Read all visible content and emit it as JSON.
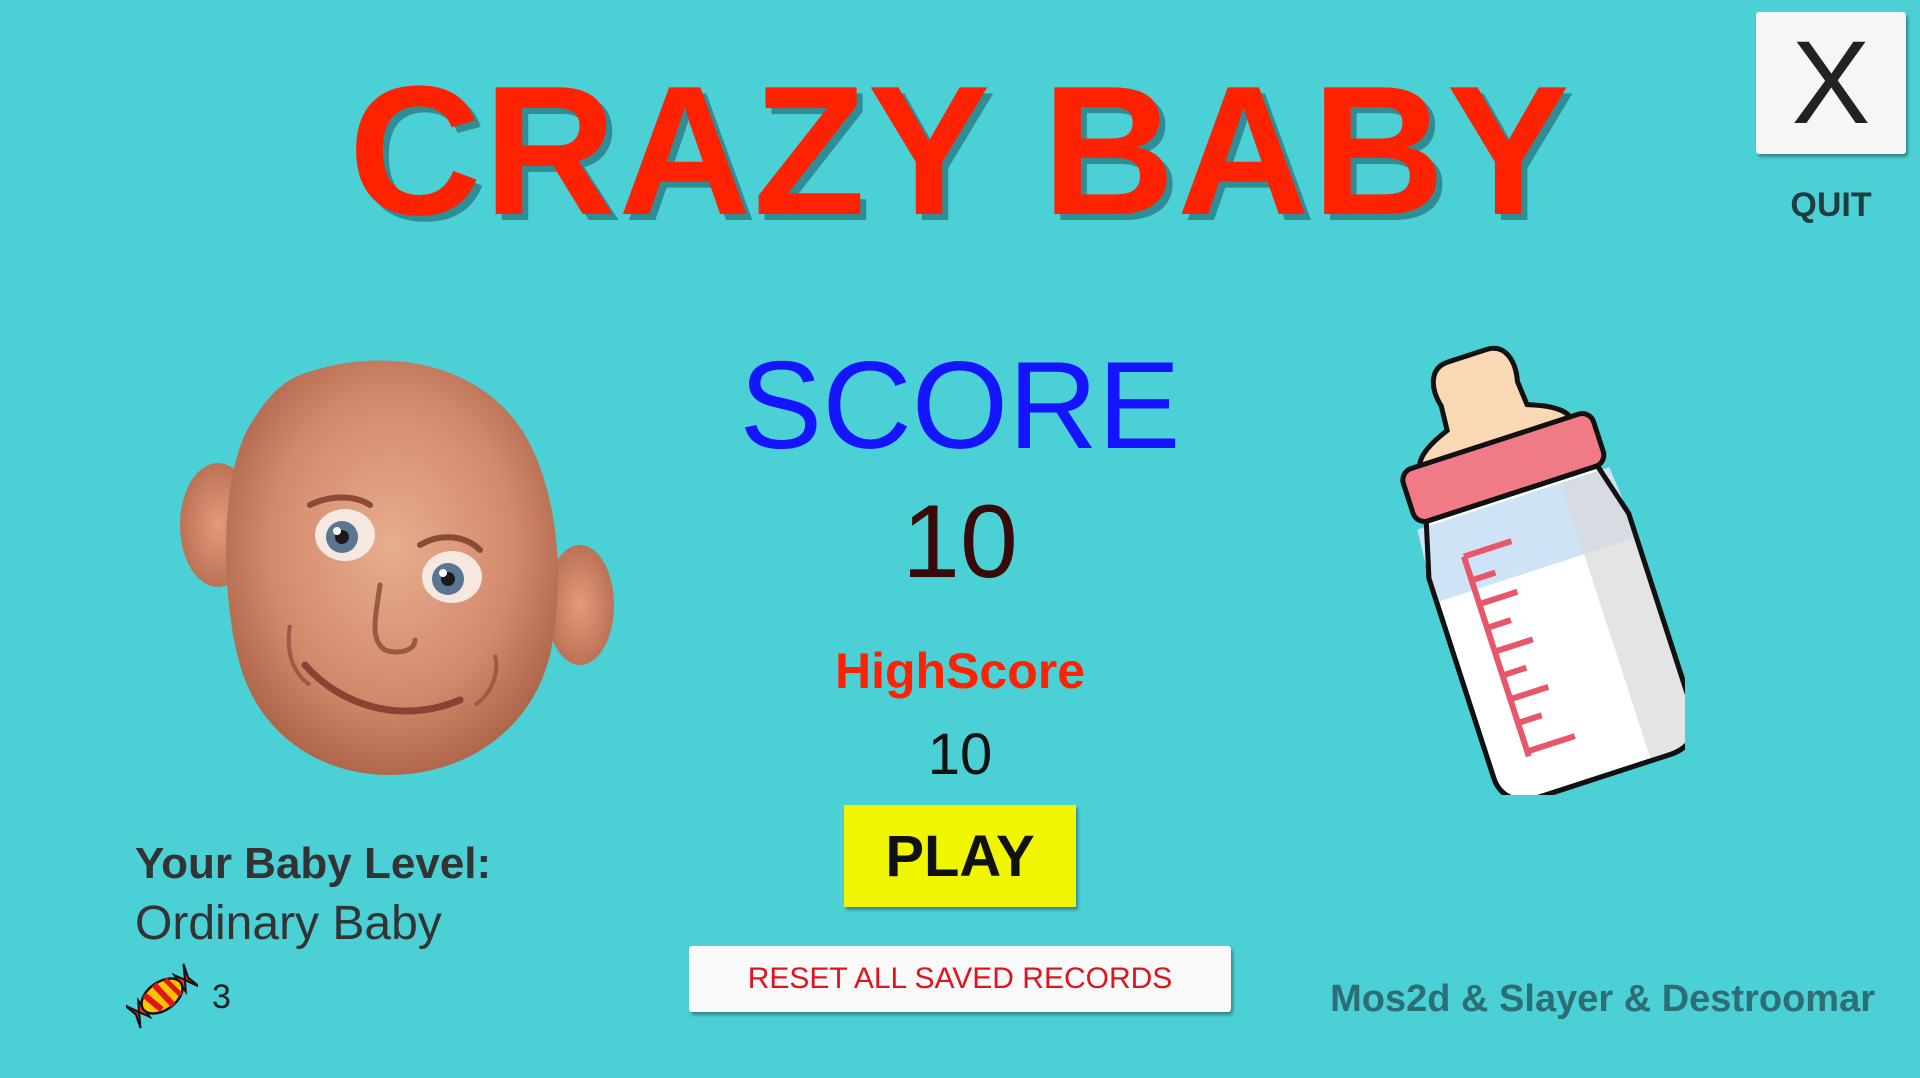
{
  "title": "CRAZY BABY",
  "quit": {
    "button_label": "X",
    "label": "QUIT"
  },
  "score": {
    "label": "SCORE",
    "value": "10"
  },
  "highscore": {
    "label": "HighScore",
    "value": "10"
  },
  "play_button": "PLAY",
  "reset_button": "RESET ALL SAVED RECORDS",
  "baby_level": {
    "label": "Your Baby Level:",
    "value": "Ordinary Baby"
  },
  "candy": {
    "icon": "candy-icon",
    "count": "3"
  },
  "credits": "Mos2d & Slayer & Destroomar",
  "colors": {
    "background": "#4bd0d6",
    "title": "#ff2200",
    "score_label": "#1414ff",
    "play_button": "#f0f500",
    "reset_text": "#e0141e"
  },
  "images": {
    "baby": "baby-face-image",
    "bottle": "baby-bottle-image"
  }
}
